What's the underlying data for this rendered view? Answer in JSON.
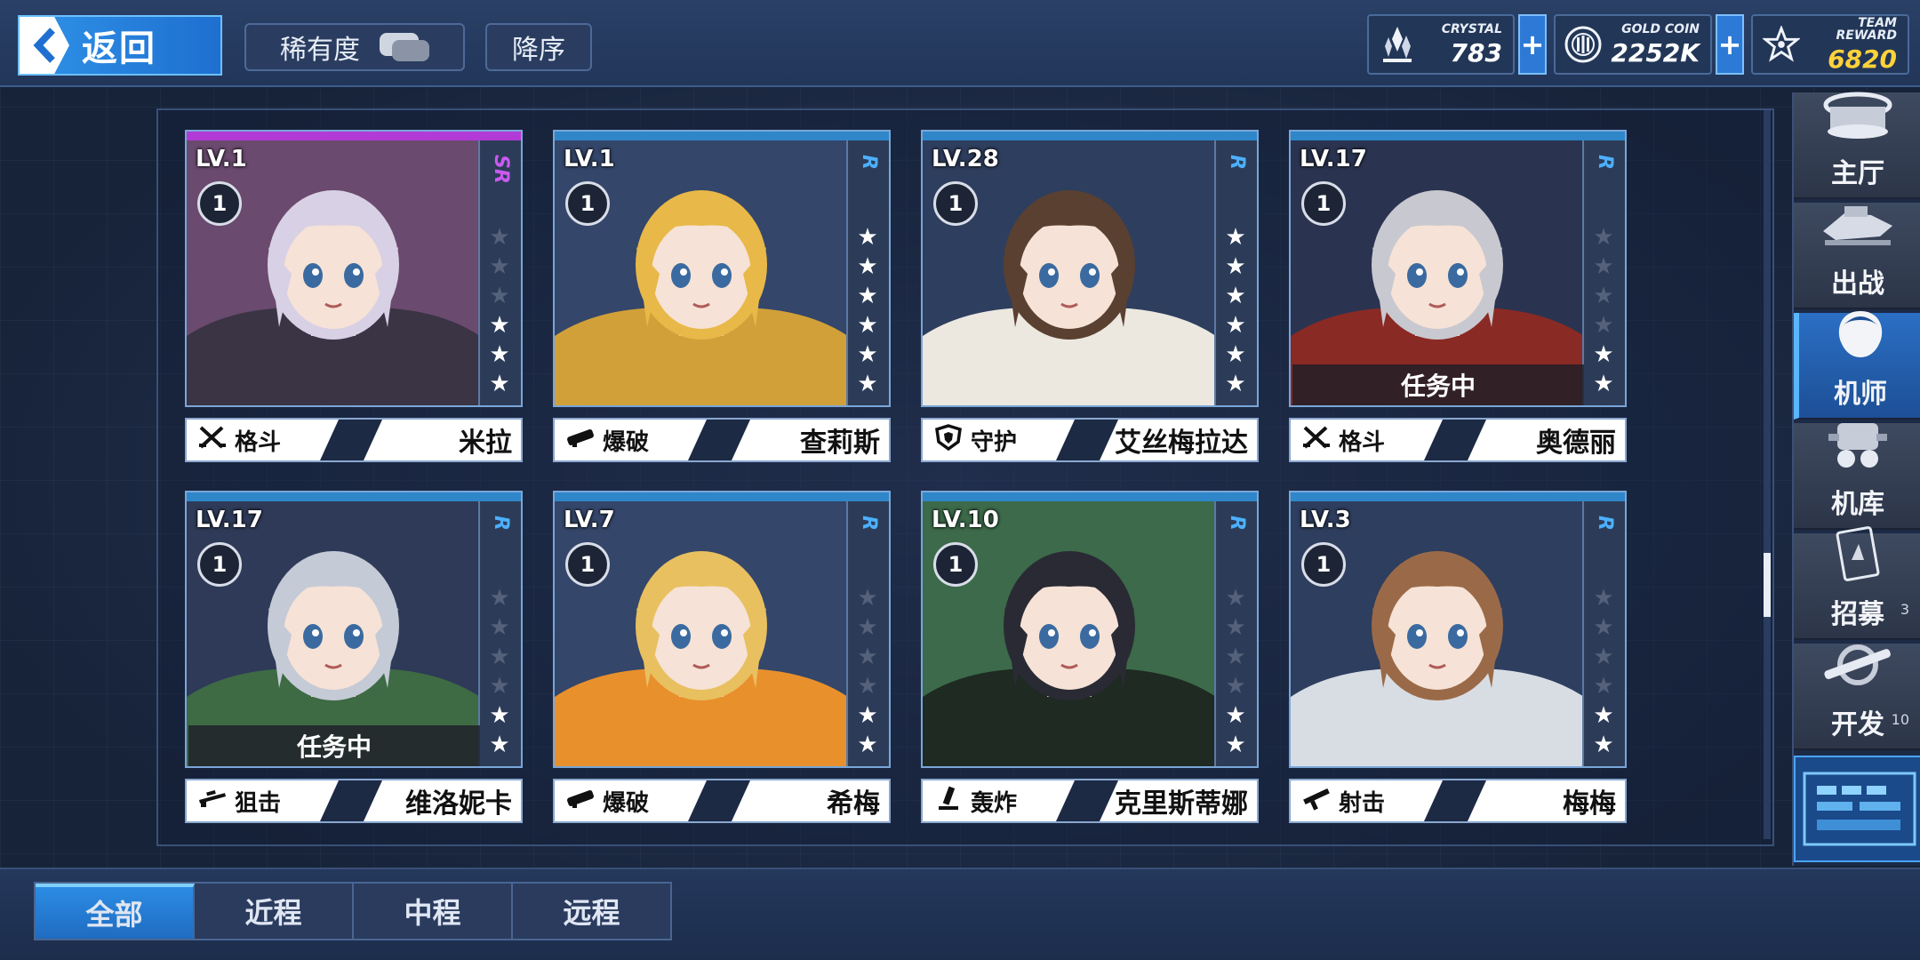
{
  "topbar": {
    "back_label": "返回",
    "rarity_label": "稀有度",
    "sort_label": "降序",
    "resources": [
      {
        "label": "CRYSTAL",
        "value": "783",
        "icon": "crystal-icon"
      },
      {
        "label": "GOLD COIN",
        "value": "2252K",
        "icon": "gold-coin-icon"
      },
      {
        "label": "TEAM REWARD",
        "value": "6820",
        "icon": "team-reward-icon"
      }
    ],
    "plus_symbol": "+"
  },
  "cards": [
    {
      "level": "LV.1",
      "rank": "1",
      "rarity": "SR",
      "stars_on": 3,
      "stars_total": 6,
      "class": "格斗",
      "class_icon": "swords-icon",
      "name": "米拉",
      "status": "",
      "hair": "#d8d0e4",
      "outfit": "#3a3444",
      "bg": "#6a4a6e"
    },
    {
      "level": "LV.1",
      "rank": "1",
      "rarity": "R",
      "stars_on": 6,
      "stars_total": 6,
      "class": "爆破",
      "class_icon": "launcher-icon",
      "name": "查莉斯",
      "status": "",
      "hair": "#e8b848",
      "outfit": "#d2a038",
      "bg": "#34466a"
    },
    {
      "level": "LV.28",
      "rank": "1",
      "rarity": "R",
      "stars_on": 6,
      "stars_total": 6,
      "class": "守护",
      "class_icon": "shield-icon",
      "name": "艾丝梅拉达",
      "status": "",
      "hair": "#5a4030",
      "outfit": "#ece8e0",
      "bg": "#2e3e5e"
    },
    {
      "level": "LV.17",
      "rank": "1",
      "rarity": "R",
      "stars_on": 2,
      "stars_total": 6,
      "class": "格斗",
      "class_icon": "swords-icon",
      "name": "奥德丽",
      "status": "任务中",
      "hair": "#c8c8d0",
      "outfit": "#8a2a24",
      "bg": "#2a3450"
    },
    {
      "level": "LV.17",
      "rank": "1",
      "rarity": "R",
      "stars_on": 2,
      "stars_total": 6,
      "class": "狙击",
      "class_icon": "sniper-rifle-icon",
      "name": "维洛妮卡",
      "status": "任务中",
      "hair": "#c4cad6",
      "outfit": "#3e6a44",
      "bg": "#2e3a58"
    },
    {
      "level": "LV.7",
      "rank": "1",
      "rarity": "R",
      "stars_on": 2,
      "stars_total": 6,
      "class": "爆破",
      "class_icon": "launcher-icon",
      "name": "希梅",
      "status": "",
      "hair": "#e8c060",
      "outfit": "#e8902c",
      "bg": "#34466a"
    },
    {
      "level": "LV.10",
      "rank": "1",
      "rarity": "R",
      "stars_on": 2,
      "stars_total": 6,
      "class": "轰炸",
      "class_icon": "mortar-icon",
      "name": "克里斯蒂娜",
      "status": "",
      "hair": "#2a2a34",
      "outfit": "#1e2a22",
      "bg": "#3c6a4a"
    },
    {
      "level": "LV.3",
      "rank": "1",
      "rarity": "R",
      "stars_on": 2,
      "stars_total": 6,
      "class": "射击",
      "class_icon": "rifle-icon",
      "name": "梅梅",
      "status": "",
      "hair": "#9a6a48",
      "outfit": "#d8dde4",
      "bg": "#2e3e5e"
    }
  ],
  "nav": {
    "items": [
      {
        "label": "主厅",
        "icon": "hall-icon",
        "count": ""
      },
      {
        "label": "出战",
        "icon": "sortie-icon",
        "count": ""
      },
      {
        "label": "机师",
        "icon": "pilot-icon",
        "count": "",
        "active": true
      },
      {
        "label": "机库",
        "icon": "hangar-icon",
        "count": ""
      },
      {
        "label": "招募",
        "icon": "recruit-card-icon",
        "count": "3"
      },
      {
        "label": "开发",
        "icon": "wrench-icon",
        "count": "10"
      }
    ]
  },
  "filters": {
    "tabs": [
      {
        "label": "全部",
        "active": true
      },
      {
        "label": "近程",
        "active": false
      },
      {
        "label": "中程",
        "active": false
      },
      {
        "label": "远程",
        "active": false
      }
    ]
  }
}
